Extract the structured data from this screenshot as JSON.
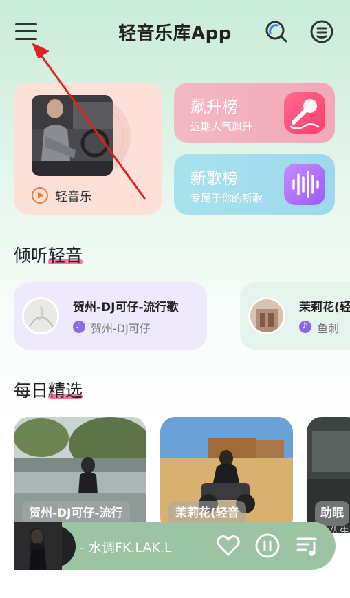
{
  "header": {
    "title": "轻音乐库App",
    "menu_icon": "menu-icon",
    "search_icon": "search-icon",
    "profile_icon": "profile-icon"
  },
  "feature": {
    "light_music_label": "轻音乐",
    "charts": [
      {
        "title": "飙升榜",
        "subtitle": "近期人气飙升",
        "icon": "microphone-icon"
      },
      {
        "title": "新歌榜",
        "subtitle": "专属于你的新歌",
        "icon": "waveform-icon"
      }
    ]
  },
  "listen": {
    "title_plain": "倾听",
    "title_highlight": "轻音",
    "songs": [
      {
        "name": "贺州-DJ可仔-流行歌",
        "artist": "贺州-DJ可仔"
      },
      {
        "name": "茉莉花(轻",
        "artist": "鱼刺"
      }
    ]
  },
  "daily": {
    "title_plain": "每日",
    "title_highlight": "精选",
    "items": [
      {
        "caption": "贺州-DJ可仔-流行"
      },
      {
        "caption": "茉莉花(轻音"
      },
      {
        "caption": "助眠"
      }
    ],
    "peek_text": "先生"
  },
  "player": {
    "now_playing": "- 水调FK.LAK.L",
    "heart_icon": "heart-icon",
    "pause_icon": "pause-icon",
    "playlist_icon": "playlist-icon"
  },
  "colors": {
    "accent_pink": "#f277a1",
    "orange": "#f27a3d",
    "player_bg": "#9bc3a4",
    "arrow": "#e02020"
  }
}
